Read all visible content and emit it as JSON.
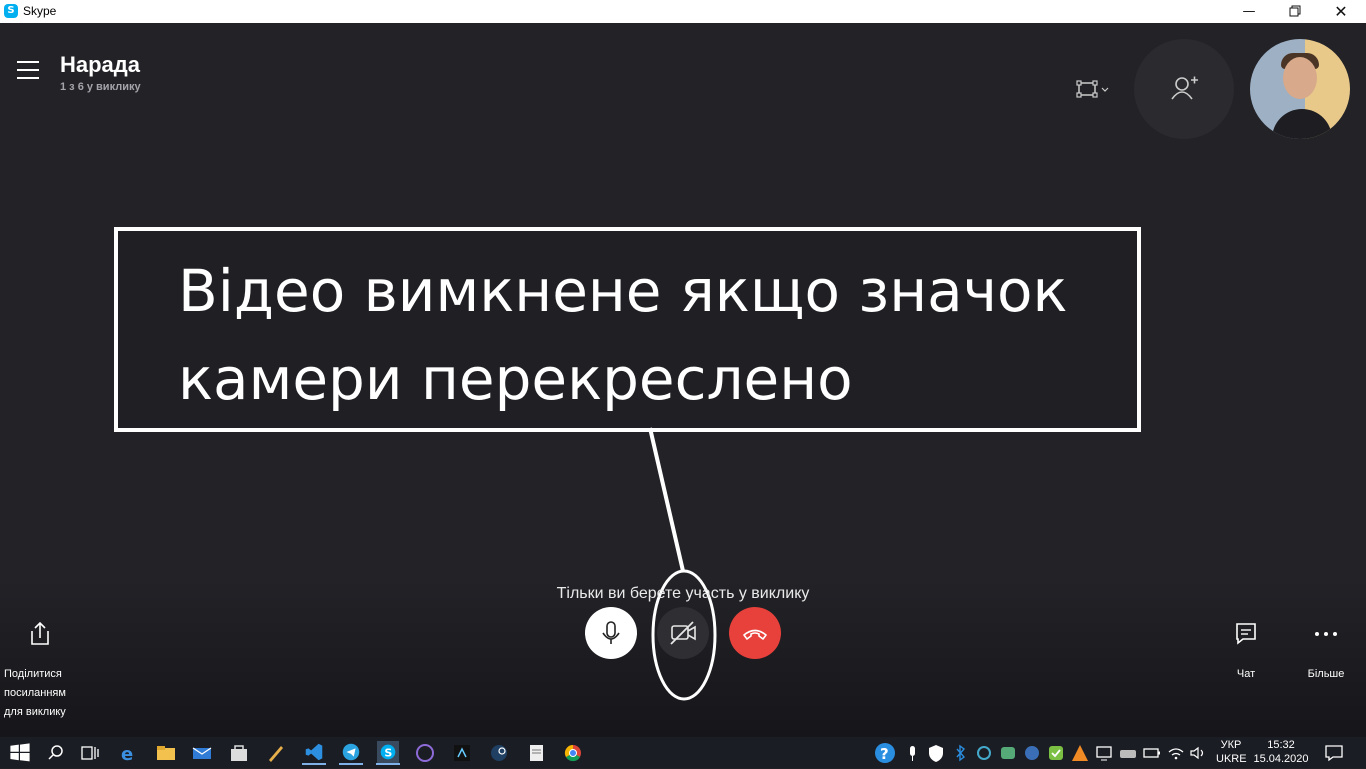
{
  "window": {
    "title": "Skype"
  },
  "call": {
    "title": "Нарада",
    "subtitle": "1 з 6 у виклику",
    "status": "Тільки ви берете участь у виклику"
  },
  "annotation": {
    "line1": "Відео вимкнене якщо значок",
    "line2": "камери перекреслено"
  },
  "controls": {
    "mic": "microphone-icon",
    "camera": "camera-off-icon",
    "end": "end-call-icon"
  },
  "side": {
    "share_line1": "Поділитися",
    "share_line2": "посиланням",
    "share_line3": "для виклику",
    "chat": "Чат",
    "more": "Більше"
  },
  "taskbar": {
    "lang_top": "УКР",
    "lang_bottom": "UKRE",
    "time": "15:32",
    "date": "15.04.2020"
  },
  "colors": {
    "background": "#222227",
    "end_call": "#e8413b",
    "skype_blue": "#00aff0"
  }
}
